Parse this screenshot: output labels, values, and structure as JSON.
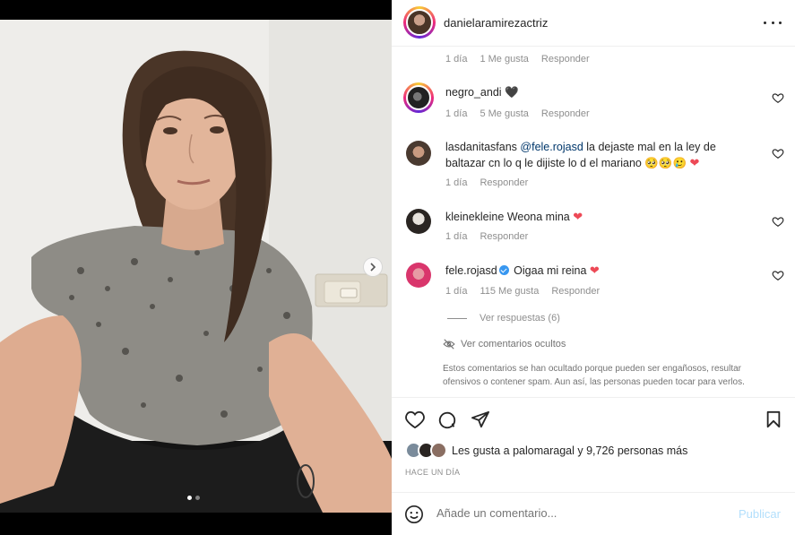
{
  "post": {
    "author": "danielaramirezactriz",
    "more_icon": "more-horizontal-icon",
    "carousel": {
      "slides": 2,
      "current": 1
    }
  },
  "comments": [
    {
      "user": "",
      "text": "",
      "time": "1 día",
      "likes": "1 Me gusta",
      "reply": "Responder"
    },
    {
      "user": "negro_andi",
      "text": "🖤",
      "time": "1 día",
      "likes": "5 Me gusta",
      "reply": "Responder"
    },
    {
      "user": "lasdanitasfans",
      "mention": "@fele.rojasd",
      "text": " la dejaste mal en la ley de baltazar cn lo q le dijiste lo d el mariano 🥺🥺🥲",
      "heart": "❤",
      "time": "1 día",
      "reply": "Responder"
    },
    {
      "user": "kleinekleine",
      "text": "Weona mina ",
      "heart": "❤",
      "time": "1 día",
      "reply": "Responder"
    },
    {
      "user": "fele.rojasd",
      "text": " Oigaa mi reina ",
      "heart": "❤",
      "time": "1 día",
      "likes": "115 Me gusta",
      "reply": "Responder",
      "verified": true
    }
  ],
  "view_replies": "Ver respuestas (6)",
  "hidden_comments": {
    "toggle": "Ver comentarios ocultos",
    "note": "Estos comentarios se han ocultado porque pueden ser engañosos, resultar ofensivos o contener spam. Aun así, las personas pueden tocar para verlos."
  },
  "likes_summary": "Les gusta a palomaragal y 9,726 personas más",
  "time_ago": "HACE UN DÍA",
  "add_comment": {
    "placeholder": "Añade un comentario...",
    "publish": "Publicar"
  },
  "colors": {
    "accent": "#0095f6",
    "publish_disabled": "#b2dffc",
    "heart": "#ed4956",
    "mention": "#00376b"
  }
}
